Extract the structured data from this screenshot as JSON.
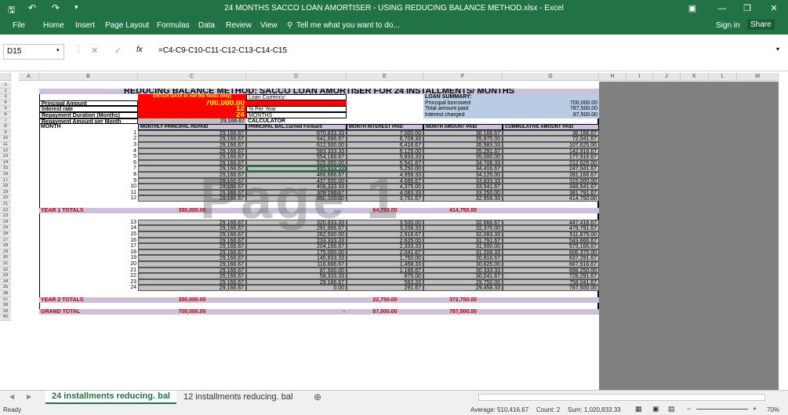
{
  "window": {
    "title": "24 MONTHS SACCO LOAN AMORTISER - USING REDUCING BALANCE METHOD.xlsx - Excel"
  },
  "ribbon": {
    "tabs": [
      "File",
      "Home",
      "Insert",
      "Page Layout",
      "Formulas",
      "Data",
      "Review",
      "View"
    ],
    "tell": "Tell me what you want to do...",
    "signin": "Sign in",
    "share": "Share"
  },
  "formula_bar": {
    "name_box": "D15",
    "fx": "fx",
    "formula": "=C4-C9-C10-C11-C12-C13-C14-C15"
  },
  "columns": [
    "A",
    "B",
    "C",
    "D",
    "E",
    "F",
    "G",
    "H",
    "I",
    "J",
    "K",
    "L",
    "M"
  ],
  "sheet": {
    "title": "REDUCING BALANCE METHOD: SACCO  LOAN  AMORTISER FOR 24 INSTALLMENTS/ MONTHS",
    "enter_note": "ENTER DATA in red the fields only)",
    "loan_currency": "Loan Currency:",
    "principal_label": "Principal Amount",
    "principal": "700,000.00",
    "rate_label": "Interest rate",
    "rate": "12",
    "rate_unit": "% Per Year",
    "dur_label": "Repayment Duration (Months)",
    "dur": "24",
    "dur_unit": "MONTHS",
    "rep_label": "Repayment Amount per Month",
    "rep": "29,166.67",
    "calc": "CALCULATOR",
    "month_label": "MONTH",
    "headers": [
      "MONTHLY PRINCIPAL REPAID",
      "PRINCIPAL BAL.Carried Forward",
      "MONTH INTEREST PAID",
      "MONTH AMOUNT PAID",
      "CUMMULATIVE AMOUNT PAID"
    ],
    "summary_title": "LOAN SUMMARY:",
    "summary": [
      [
        "Principal borrowed",
        "700,000.00"
      ],
      [
        "Total amount paid",
        "787,500.00"
      ],
      [
        "Interest charged",
        "87,500.00"
      ]
    ],
    "year1": [
      [
        "1",
        "29,166.67",
        "670,833.33",
        "7,000.00",
        "36,166.67",
        "36,166.67"
      ],
      [
        "2",
        "29,166.67",
        "641,666.67",
        "6,708.33",
        "35,875.00",
        "72,041.67"
      ],
      [
        "3",
        "29,166.67",
        "612,500.00",
        "6,416.67",
        "35,583.33",
        "107,625.00"
      ],
      [
        "4",
        "29,166.67",
        "583,333.33",
        "6,125.00",
        "35,291.67",
        "142,916.67"
      ],
      [
        "5",
        "29,166.67",
        "554,166.67",
        "5,833.33",
        "35,000.00",
        "177,916.67"
      ],
      [
        "6",
        "29,166.67",
        "525,000.00",
        "5,541.67",
        "34,708.33",
        "212,625.00"
      ],
      [
        "7",
        "29,166.67",
        "495,833.33",
        "5,250.00",
        "34,416.67",
        "247,041.67"
      ],
      [
        "8",
        "29,166.67",
        "466,666.67",
        "4,958.33",
        "34,125.00",
        "281,166.67"
      ],
      [
        "9",
        "29,166.67",
        "437,500.00",
        "4,666.67",
        "33,833.33",
        "315,000.00"
      ],
      [
        "10",
        "29,166.67",
        "408,333.33",
        "4,375.00",
        "33,541.67",
        "348,541.67"
      ],
      [
        "11",
        "29,166.67",
        "379,166.67",
        "4,083.33",
        "33,250.00",
        "381,791.67"
      ],
      [
        "12",
        "29,166.67",
        "350,000.00",
        "3,791.67",
        "32,958.33",
        "414,750.00"
      ]
    ],
    "year1_totals": [
      "YEAR 1 TOTALS",
      "350,000.00",
      "64,750.00",
      "414,750.00"
    ],
    "year2": [
      [
        "13",
        "29,166.67",
        "320,833.33",
        "3,500.00",
        "32,666.67",
        "447,416.67"
      ],
      [
        "14",
        "29,166.67",
        "291,666.67",
        "3,208.33",
        "32,375.00",
        "479,791.67"
      ],
      [
        "15",
        "29,166.67",
        "262,500.00",
        "2,916.67",
        "32,083.33",
        "511,875.00"
      ],
      [
        "16",
        "29,166.67",
        "233,333.33",
        "2,625.00",
        "31,791.67",
        "543,666.67"
      ],
      [
        "17",
        "29,166.67",
        "204,166.67",
        "2,333.33",
        "31,500.00",
        "575,166.67"
      ],
      [
        "18",
        "29,166.67",
        "175,000.00",
        "2,041.67",
        "31,208.33",
        "606,375.00"
      ],
      [
        "19",
        "29,166.67",
        "145,833.33",
        "1,750.00",
        "30,916.67",
        "637,291.67"
      ],
      [
        "20",
        "29,166.67",
        "116,666.67",
        "1,458.33",
        "30,625.00",
        "667,916.67"
      ],
      [
        "21",
        "29,166.67",
        "87,500.00",
        "1,166.67",
        "30,333.33",
        "698,250.00"
      ],
      [
        "22",
        "29,166.67",
        "58,333.33",
        "875.00",
        "30,041.67",
        "728,291.67"
      ],
      [
        "23",
        "29,166.67",
        "29,166.67",
        "583.33",
        "29,750.00",
        "758,041.67"
      ],
      [
        "24",
        "29,166.67",
        "0.00",
        "291.67",
        "29,458.33",
        "787,500.00"
      ]
    ],
    "year2_totals": [
      "YEAR 2 TOTALS",
      "350,000.00",
      "22,750.00",
      "372,750.00"
    ],
    "grand_totals": [
      "GRAND TOTAL",
      "700,000.00",
      "-",
      "87,500.00",
      "787,500.00"
    ],
    "watermark": "Page 1"
  },
  "tabs": [
    "24 installments reducing. bal",
    "12 installments reducing. bal"
  ],
  "status": {
    "ready": "Ready",
    "average": "Average: 510,416.67",
    "count": "Count: 2",
    "sum": "Sum: 1,020,833.33",
    "zoom": "70%"
  }
}
